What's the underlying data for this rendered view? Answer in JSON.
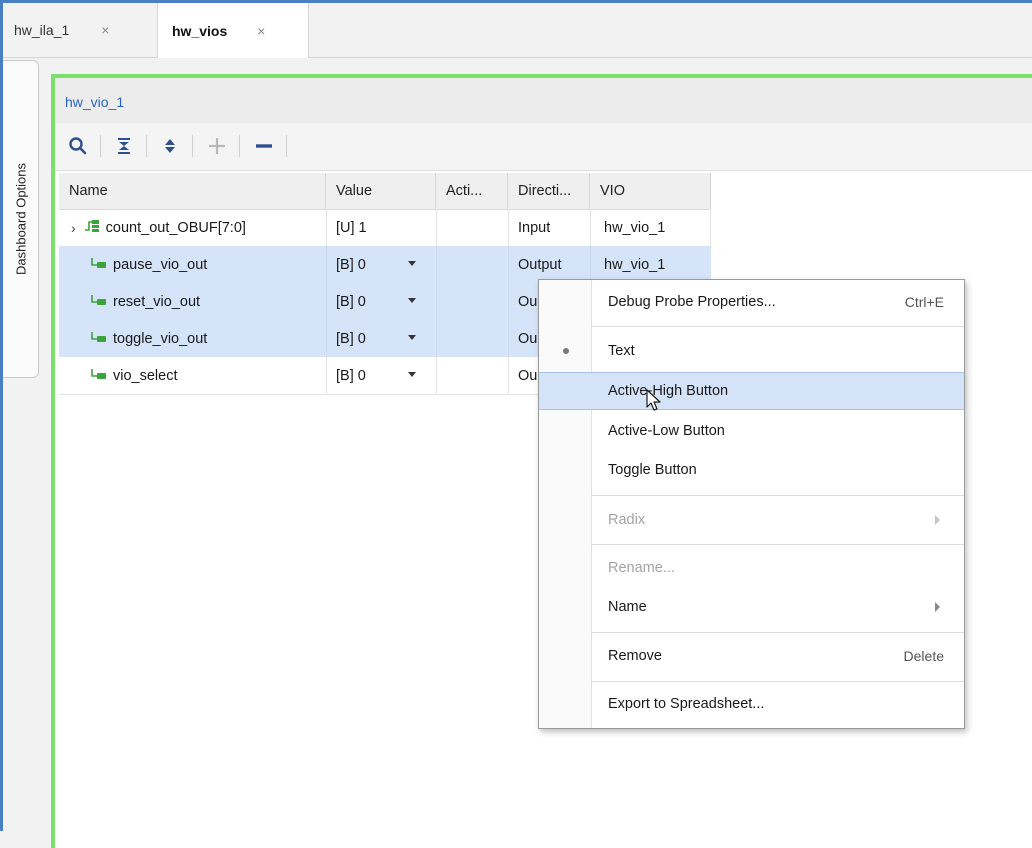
{
  "tabs": [
    {
      "label": "hw_ila_1",
      "close": "×"
    },
    {
      "label": "hw_vios",
      "close": "×"
    }
  ],
  "side_tab": {
    "label": "Dashboard Options"
  },
  "panel": {
    "title": "hw_vio_1"
  },
  "toolbar": {
    "icons": [
      "search-icon",
      "collapse-all-icon",
      "expand-all-icon",
      "add-icon",
      "remove-icon"
    ]
  },
  "table": {
    "columns": [
      "Name",
      "Value",
      "Acti...",
      "Directi...",
      "VIO"
    ],
    "rows": [
      {
        "name": "count_out_OBUF[7:0]",
        "value": "[U] 1",
        "activity": "",
        "direction": "Input",
        "vio": "hw_vio_1",
        "selected": false,
        "expandable": true,
        "icon": "bus-icon"
      },
      {
        "name": "pause_vio_out",
        "value": "[B] 0",
        "activity": "",
        "direction": "Output",
        "vio": "hw_vio_1",
        "selected": true,
        "expandable": false,
        "icon": "signal-icon"
      },
      {
        "name": "reset_vio_out",
        "value": "[B] 0",
        "activity": "",
        "direction": "Ou",
        "vio": "",
        "selected": true,
        "expandable": false,
        "icon": "signal-icon"
      },
      {
        "name": "toggle_vio_out",
        "value": "[B] 0",
        "activity": "",
        "direction": "Ou",
        "vio": "",
        "selected": true,
        "expandable": false,
        "icon": "signal-icon"
      },
      {
        "name": "vio_select",
        "value": "[B] 0",
        "activity": "",
        "direction": "Ou",
        "vio": "",
        "selected": false,
        "expandable": false,
        "icon": "signal-icon"
      }
    ]
  },
  "context_menu": {
    "items": [
      {
        "label": "Debug Probe Properties...",
        "shortcut": "Ctrl+E"
      },
      {
        "label": "Text",
        "checked": true
      },
      {
        "label": "Active-High Button",
        "highlighted": true
      },
      {
        "label": "Active-Low Button"
      },
      {
        "label": "Toggle Button"
      },
      {
        "label": "Radix",
        "disabled": true,
        "submenu": true
      },
      {
        "label": "Rename...",
        "disabled": true
      },
      {
        "label": "Name",
        "submenu": true
      },
      {
        "label": "Remove",
        "shortcut": "Delete"
      },
      {
        "label": "Export to Spreadsheet..."
      }
    ]
  },
  "colors": {
    "accent_blue": "#4a7fc4",
    "panel_border_green": "#7be06a",
    "selection": "#d6e4fa",
    "title_link": "#2a63c4"
  }
}
